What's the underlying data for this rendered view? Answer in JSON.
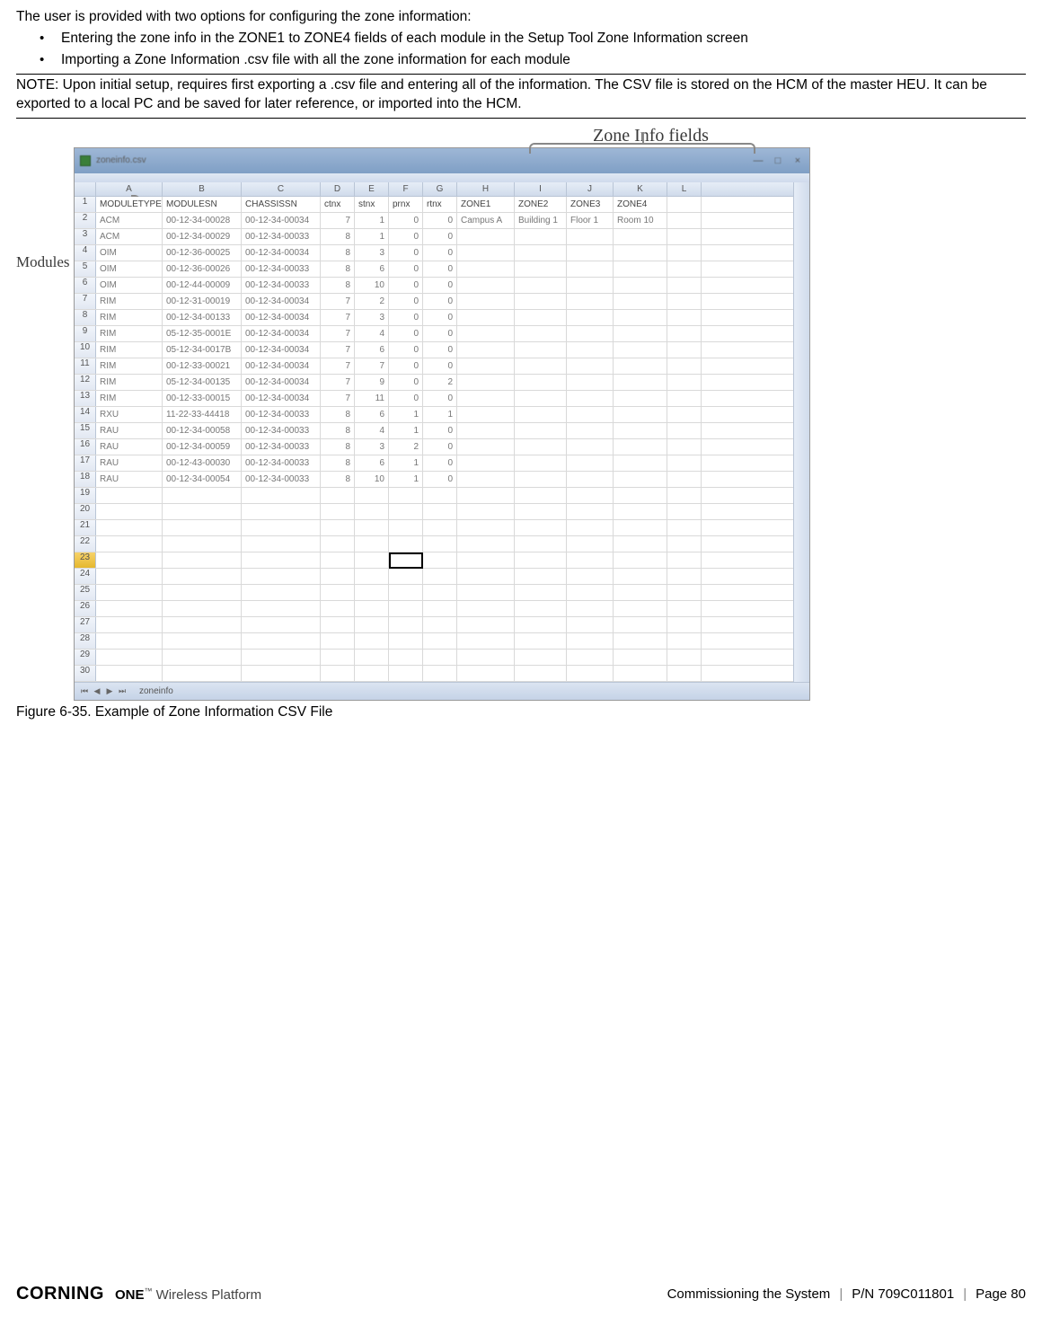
{
  "intro": "The user is provided with two options for configuring the zone information:",
  "bullets": [
    "Entering the zone info in the ZONE1 to   ZONE4 fields of each module in the Setup Tool Zone Information screen",
    "Importing a Zone Information .csv file with all the zone information for each module"
  ],
  "note": "NOTE: Upon initial setup, requires first exporting a .csv file and entering all of the information. The CSV file is stored on the HCM of the master HEU. It can be exported to a local PC and be saved for later reference, or imported into the HCM.",
  "annotations": {
    "zone_fields": "Zone Info fields",
    "modules": "Modules"
  },
  "excel": {
    "title": "zoneinfo.csv",
    "col_letters": [
      "A",
      "B",
      "C",
      "D",
      "E",
      "F",
      "G",
      "H",
      "I",
      "J",
      "K",
      "L"
    ],
    "headers": [
      "MODULETYPE",
      "MODULESN",
      "CHASSISSN",
      "ctnx",
      "stnx",
      "prnx",
      "rtnx",
      "ZONE1",
      "ZONE2",
      "ZONE3",
      "ZONE4",
      ""
    ],
    "rows": [
      {
        "n": 2,
        "c": [
          "ACM",
          "00-12-34-00028",
          "00-12-34-00034",
          "7",
          "1",
          "0",
          "0",
          "Campus A",
          "Building 1",
          "Floor 1",
          "Room 10",
          ""
        ]
      },
      {
        "n": 3,
        "c": [
          "ACM",
          "00-12-34-00029",
          "00-12-34-00033",
          "8",
          "1",
          "0",
          "0",
          "",
          "",
          "",
          "",
          ""
        ]
      },
      {
        "n": 4,
        "c": [
          "OIM",
          "00-12-36-00025",
          "00-12-34-00034",
          "8",
          "3",
          "0",
          "0",
          "",
          "",
          "",
          "",
          ""
        ]
      },
      {
        "n": 5,
        "c": [
          "OIM",
          "00-12-36-00026",
          "00-12-34-00033",
          "8",
          "6",
          "0",
          "0",
          "",
          "",
          "",
          "",
          ""
        ]
      },
      {
        "n": 6,
        "c": [
          "OIM",
          "00-12-44-00009",
          "00-12-34-00033",
          "8",
          "10",
          "0",
          "0",
          "",
          "",
          "",
          "",
          ""
        ]
      },
      {
        "n": 7,
        "c": [
          "RIM",
          "00-12-31-00019",
          "00-12-34-00034",
          "7",
          "2",
          "0",
          "0",
          "",
          "",
          "",
          "",
          ""
        ]
      },
      {
        "n": 8,
        "c": [
          "RIM",
          "00-12-34-00133",
          "00-12-34-00034",
          "7",
          "3",
          "0",
          "0",
          "",
          "",
          "",
          "",
          ""
        ]
      },
      {
        "n": 9,
        "c": [
          "RIM",
          "05-12-35-0001E",
          "00-12-34-00034",
          "7",
          "4",
          "0",
          "0",
          "",
          "",
          "",
          "",
          ""
        ]
      },
      {
        "n": 10,
        "c": [
          "RIM",
          "05-12-34-0017B",
          "00-12-34-00034",
          "7",
          "6",
          "0",
          "0",
          "",
          "",
          "",
          "",
          ""
        ]
      },
      {
        "n": 11,
        "c": [
          "RIM",
          "00-12-33-00021",
          "00-12-34-00034",
          "7",
          "7",
          "0",
          "0",
          "",
          "",
          "",
          "",
          ""
        ]
      },
      {
        "n": 12,
        "c": [
          "RIM",
          "05-12-34-00135",
          "00-12-34-00034",
          "7",
          "9",
          "0",
          "2",
          "",
          "",
          "",
          "",
          ""
        ]
      },
      {
        "n": 13,
        "c": [
          "RIM",
          "00-12-33-00015",
          "00-12-34-00034",
          "7",
          "11",
          "0",
          "0",
          "",
          "",
          "",
          "",
          ""
        ]
      },
      {
        "n": 14,
        "c": [
          "RXU",
          "11-22-33-44418",
          "00-12-34-00033",
          "8",
          "6",
          "1",
          "1",
          "",
          "",
          "",
          "",
          ""
        ]
      },
      {
        "n": 15,
        "c": [
          "RAU",
          "00-12-34-00058",
          "00-12-34-00033",
          "8",
          "4",
          "1",
          "0",
          "",
          "",
          "",
          "",
          ""
        ]
      },
      {
        "n": 16,
        "c": [
          "RAU",
          "00-12-34-00059",
          "00-12-34-00033",
          "8",
          "3",
          "2",
          "0",
          "",
          "",
          "",
          "",
          ""
        ]
      },
      {
        "n": 17,
        "c": [
          "RAU",
          "00-12-43-00030",
          "00-12-34-00033",
          "8",
          "6",
          "1",
          "0",
          "",
          "",
          "",
          "",
          ""
        ]
      },
      {
        "n": 18,
        "c": [
          "RAU",
          "00-12-34-00054",
          "00-12-34-00033",
          "8",
          "10",
          "1",
          "0",
          "",
          "",
          "",
          "",
          ""
        ]
      }
    ],
    "empty_rows": [
      19,
      20,
      21,
      22,
      23,
      24,
      25,
      26,
      27,
      28,
      29,
      30
    ],
    "highlighted_row": 23,
    "selected_cell_row": 23,
    "selected_cell_col_index": 5,
    "sheet_tab": "zoneinfo"
  },
  "figure_caption": "Figure 6-35. Example of Zone Information CSV File",
  "footer": {
    "brand_primary": "CORNING",
    "brand_secondary_html": "ONE™ Wireless Platform",
    "section": "Commissioning the System",
    "pn": "P/N 709C011801",
    "page": "Page 80"
  }
}
